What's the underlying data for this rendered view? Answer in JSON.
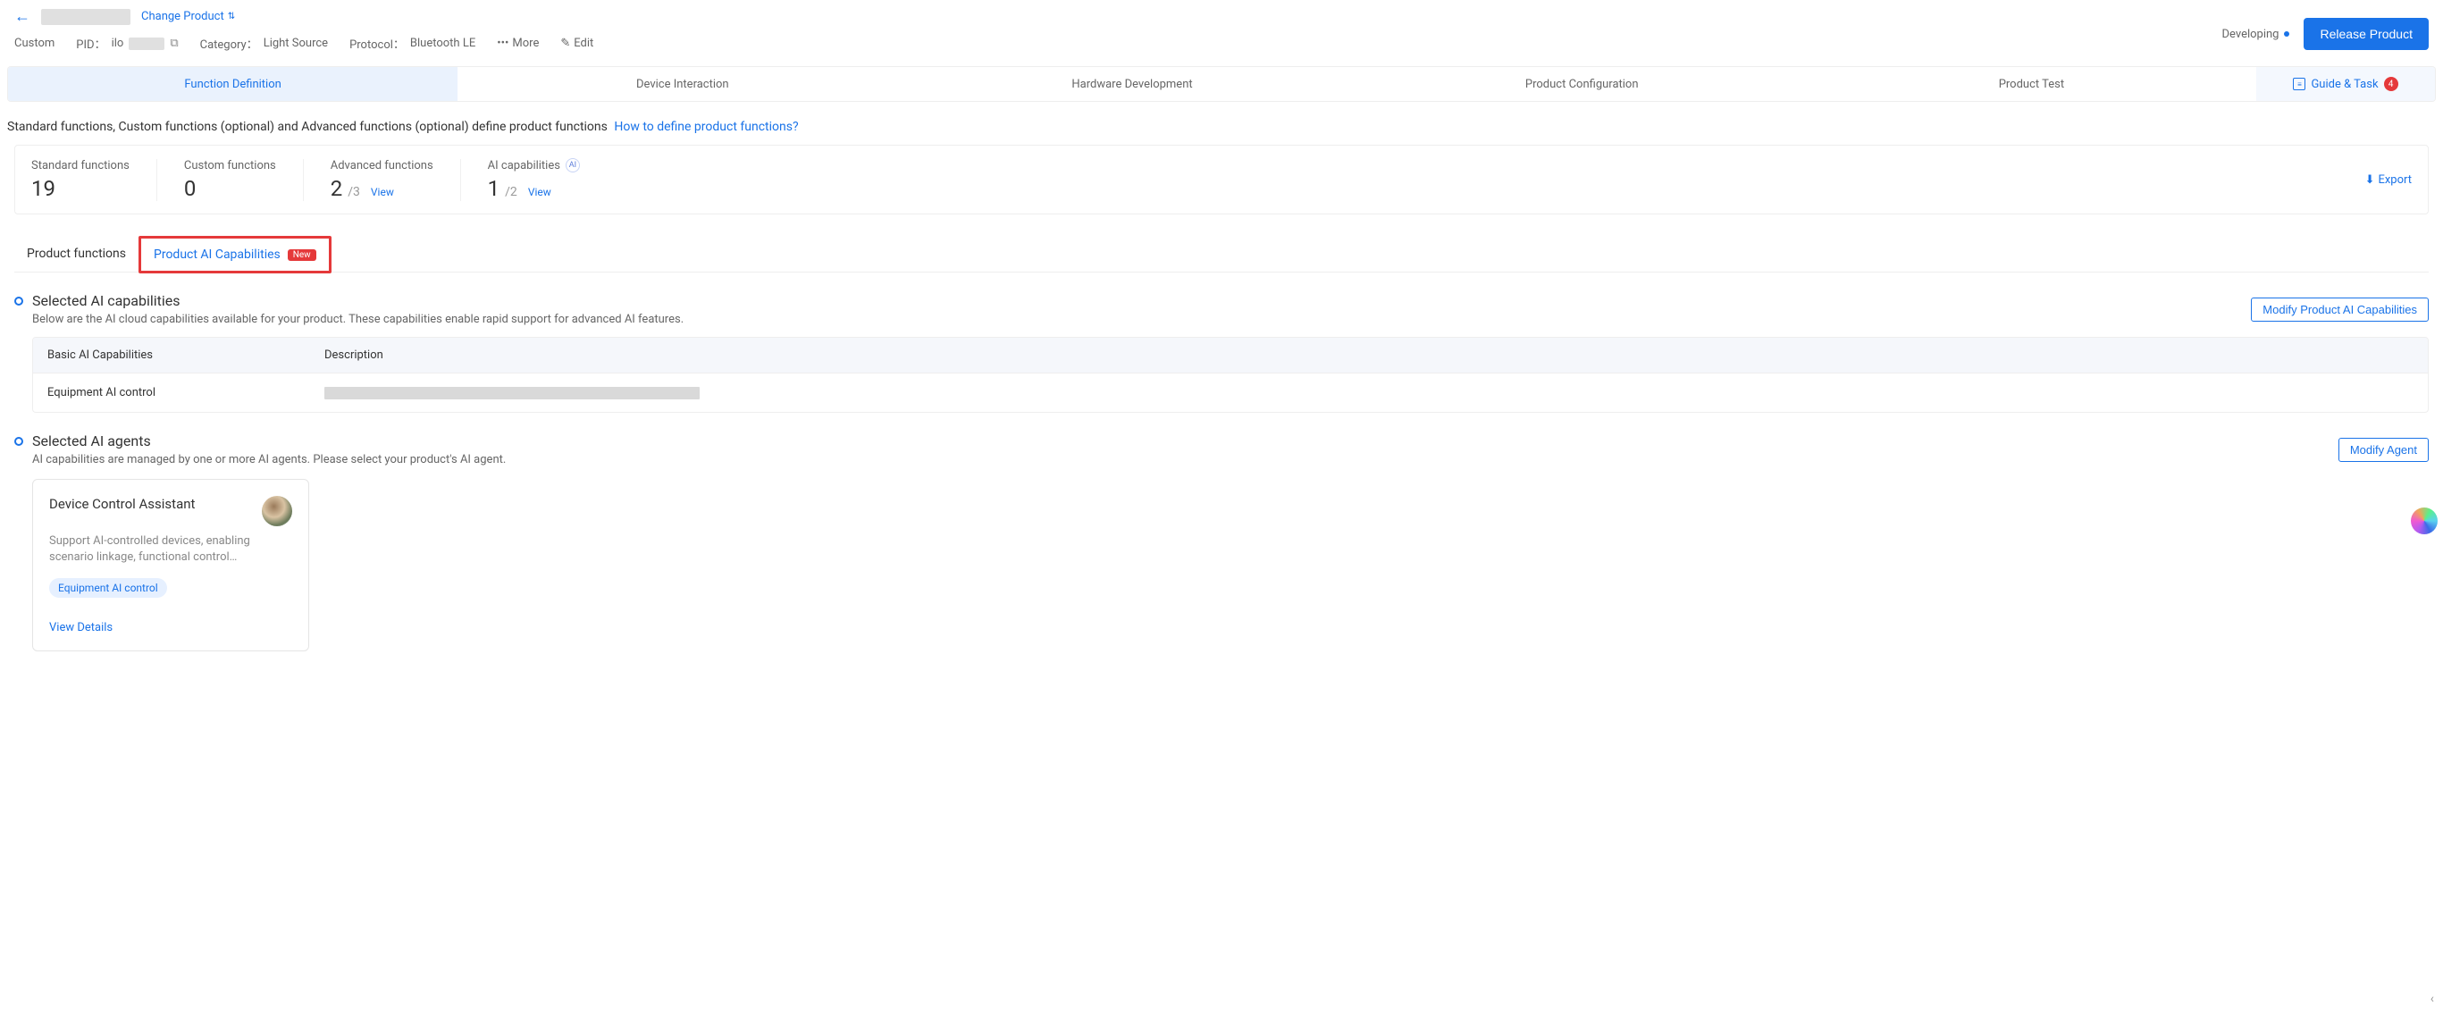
{
  "header": {
    "change_product": "Change Product",
    "custom_label": "Custom",
    "pid_label": "PID：",
    "pid_prefix": "ilo",
    "category_label": "Category：",
    "category_value": "Light Source",
    "protocol_label": "Protocol：",
    "protocol_value": "Bluetooth LE",
    "more_label": "More",
    "edit_label": "Edit",
    "status_label": "Developing",
    "release_label": "Release Product"
  },
  "progress": {
    "tabs": [
      "Function Definition",
      "Device Interaction",
      "Hardware Development",
      "Product Configuration",
      "Product Test"
    ],
    "guide_label": "Guide & Task",
    "guide_count": "4"
  },
  "desc": {
    "text": "Standard functions, Custom functions (optional) and Advanced functions (optional) define product functions",
    "link": "How to define product functions?"
  },
  "stats": {
    "standard": {
      "label": "Standard functions",
      "value": "19"
    },
    "custom": {
      "label": "Custom functions",
      "value": "0"
    },
    "advanced": {
      "label": "Advanced functions",
      "value": "2",
      "total": "/3",
      "view": "View"
    },
    "ai": {
      "label": "AI capabilities",
      "value": "1",
      "total": "/2",
      "view": "View"
    },
    "export": "Export"
  },
  "subtabs": {
    "product_functions": "Product functions",
    "ai_capabilities": "Product AI Capabilities",
    "new_badge": "New"
  },
  "selected_caps": {
    "title": "Selected AI capabilities",
    "desc": "Below are the AI cloud capabilities available for your product. These capabilities enable rapid support for advanced AI features.",
    "modify_btn": "Modify Product AI Capabilities",
    "col_basic": "Basic AI Capabilities",
    "col_desc": "Description",
    "row_name": "Equipment AI control"
  },
  "selected_agents": {
    "title": "Selected AI agents",
    "desc": "AI capabilities are managed by one or more AI agents. Please select your product's AI agent.",
    "modify_btn": "Modify Agent",
    "card": {
      "title": "Device Control Assistant",
      "desc": "Support AI-controlled devices, enabling scenario linkage, functional control…",
      "tag": "Equipment AI control",
      "view": "View Details"
    }
  }
}
